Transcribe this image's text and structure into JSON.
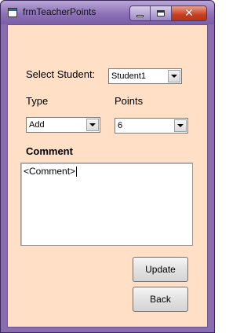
{
  "window": {
    "title": "frmTeacherPoints",
    "caption_buttons": {
      "minimize": "minimize",
      "maximize": "maximize",
      "close": "close"
    }
  },
  "form": {
    "select_student_label": "Select Student:",
    "student_value": "Student1",
    "type_label": "Type",
    "type_value": "Add",
    "points_label": "Points",
    "points_value": "6",
    "comment_label": "Comment",
    "comment_value": "<Comment>"
  },
  "buttons": {
    "update_label": "Update",
    "back_label": "Back"
  },
  "colors": {
    "client_background": "#ffdfc5",
    "frame": "#8a6cb0",
    "close_button": "#c73f20"
  }
}
